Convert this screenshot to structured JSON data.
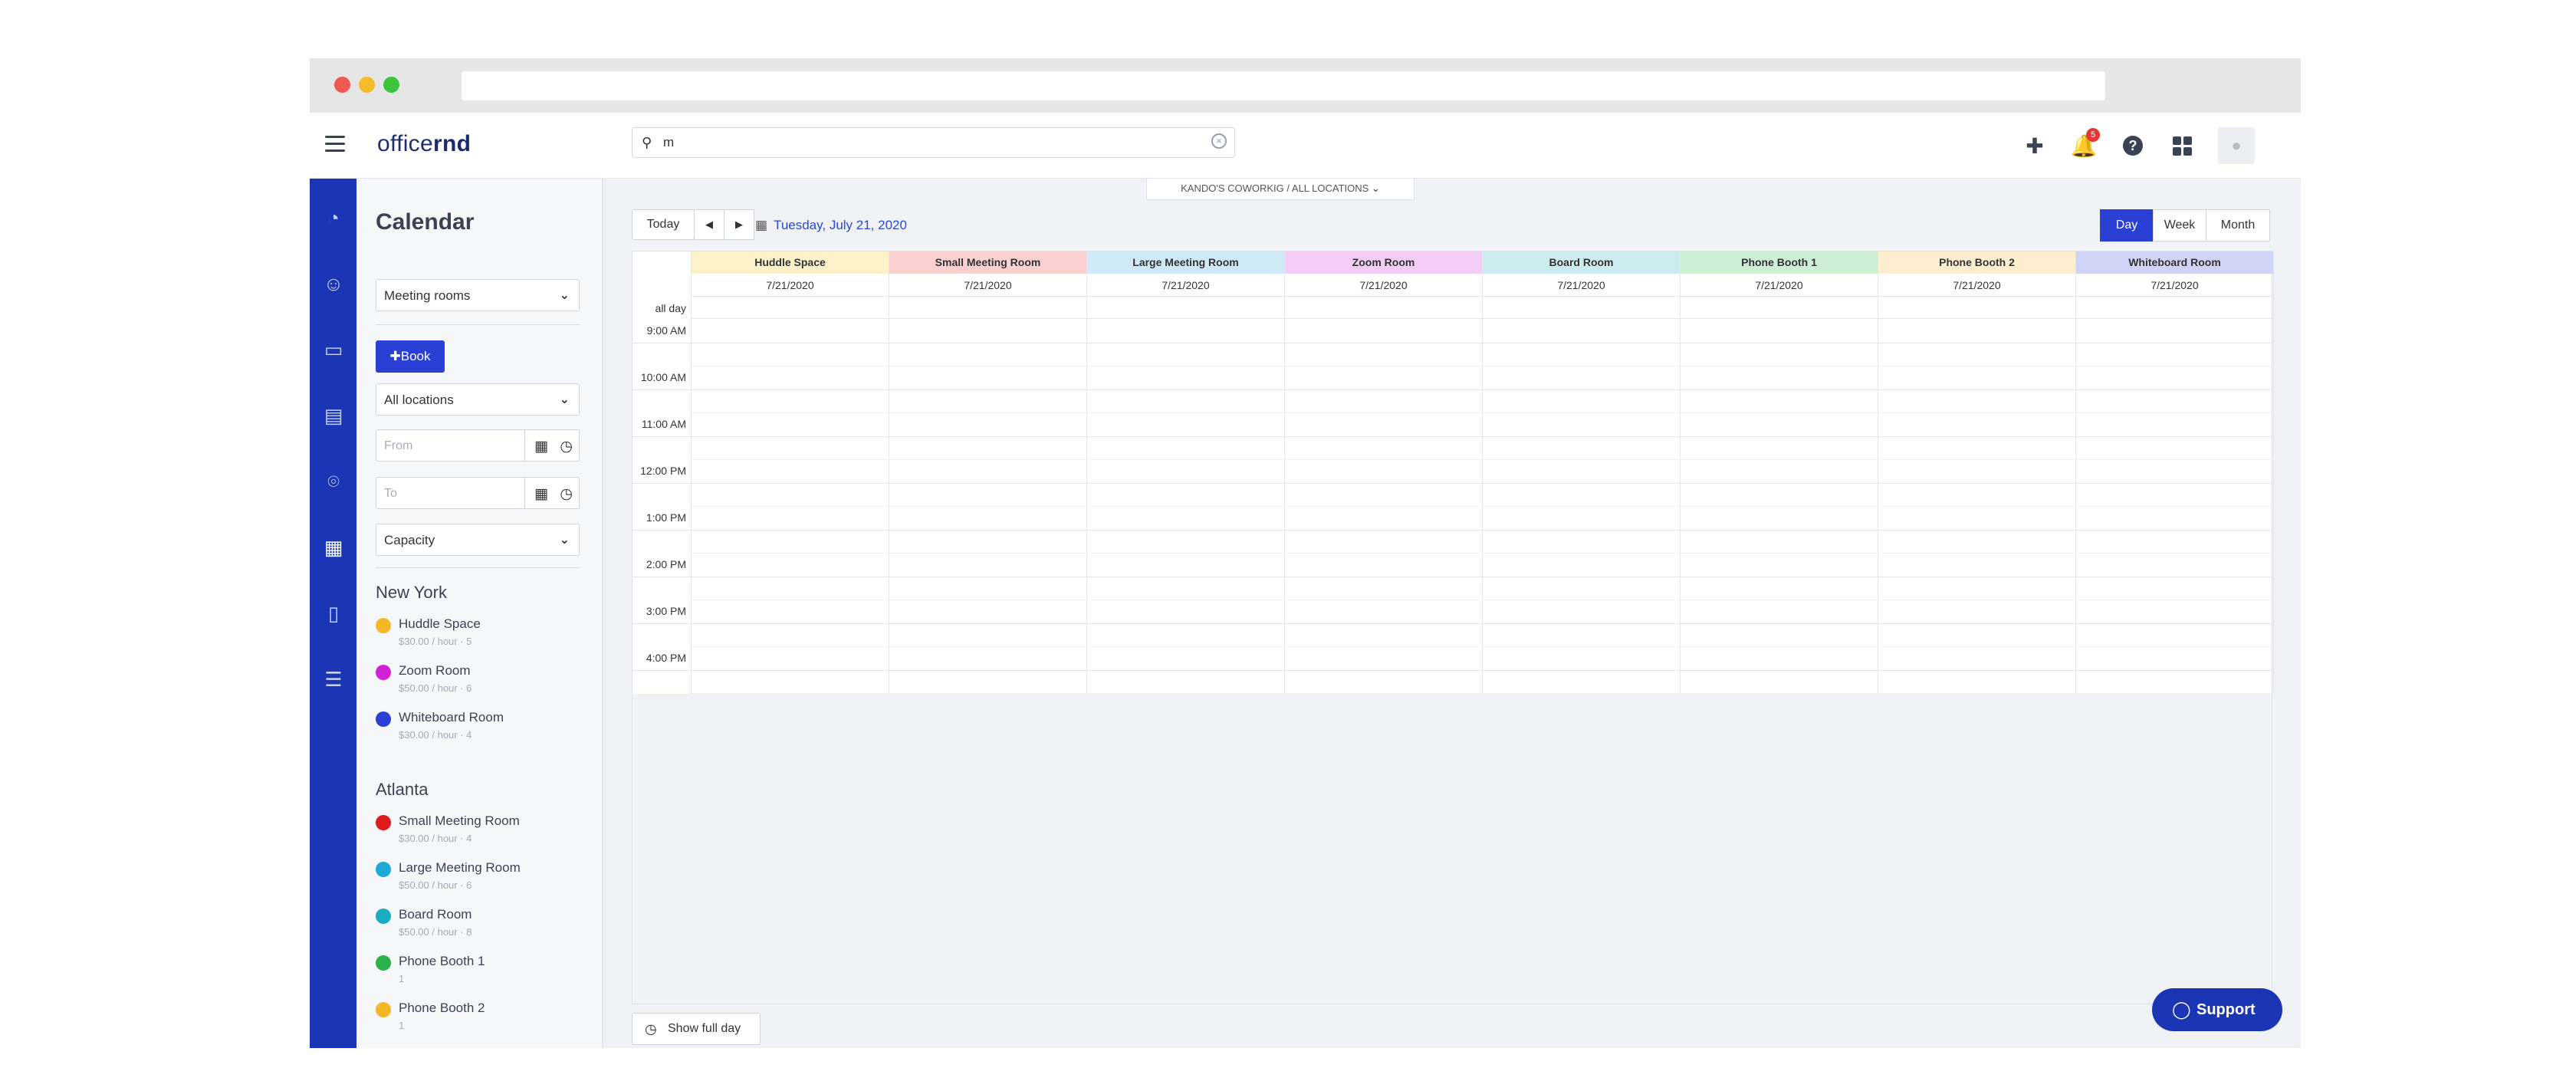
{
  "app": {
    "logo_light": "office",
    "logo_bold": "rnd"
  },
  "search": {
    "value": "m"
  },
  "header": {
    "notification_count": "5"
  },
  "sidebar": {
    "title": "Calendar",
    "resource_type": "Meeting rooms",
    "book_label": "Book",
    "locations_select": "All locations",
    "from_placeholder": "From",
    "to_placeholder": "To",
    "capacity_select": "Capacity",
    "groups": [
      {
        "name": "New York",
        "rooms": [
          {
            "name": "Huddle Space",
            "meta": "$30.00 / hour  ·  5",
            "color": "#f4b826"
          },
          {
            "name": "Zoom Room",
            "meta": "$50.00 / hour  ·  6",
            "color": "#d321d6"
          },
          {
            "name": "Whiteboard Room",
            "meta": "$30.00 / hour  ·  4",
            "color": "#2a3fd4"
          }
        ]
      },
      {
        "name": "Atlanta",
        "rooms": [
          {
            "name": "Small Meeting Room",
            "meta": "$30.00 / hour  ·  4",
            "color": "#e01b1b"
          },
          {
            "name": "Large Meeting Room",
            "meta": "$50.00 / hour  ·  6",
            "color": "#1ea9d6"
          },
          {
            "name": "Board Room",
            "meta": "$50.00 / hour  ·  8",
            "color": "#1aacc2"
          },
          {
            "name": "Phone Booth 1",
            "meta": "1",
            "color": "#2bb24c"
          },
          {
            "name": "Phone Booth 2",
            "meta": "1",
            "color": "#f4b826"
          }
        ]
      }
    ]
  },
  "main": {
    "location_tab": "KANDO'S COWORKIG  /  ALL LOCATIONS",
    "today_label": "Today",
    "prev_label": "◀",
    "next_label": "▶",
    "date_label": "Tuesday, July 21, 2020",
    "views": {
      "day": "Day",
      "week": "Week",
      "month": "Month"
    },
    "allday_label": "all day",
    "times": [
      "9:00 AM",
      "10:00 AM",
      "11:00 AM",
      "12:00 PM",
      "1:00 PM",
      "2:00 PM",
      "3:00 PM",
      "4:00 PM"
    ],
    "columns": [
      {
        "name": "Huddle Space",
        "date": "7/21/2020",
        "color": "#fbf2c9"
      },
      {
        "name": "Small Meeting Room",
        "date": "7/21/2020",
        "color": "#fbd0d0"
      },
      {
        "name": "Large Meeting Room",
        "date": "7/21/2020",
        "color": "#cfe9f7"
      },
      {
        "name": "Zoom Room",
        "date": "7/21/2020",
        "color": "#f3cdf5"
      },
      {
        "name": "Board Room",
        "date": "7/21/2020",
        "color": "#ccecf0"
      },
      {
        "name": "Phone Booth 1",
        "date": "7/21/2020",
        "color": "#cfeed6"
      },
      {
        "name": "Phone Booth 2",
        "date": "7/21/2020",
        "color": "#fdeed0"
      },
      {
        "name": "Whiteboard Room",
        "date": "7/21/2020",
        "color": "#d0d5f8"
      }
    ],
    "show_full_day": "Show full day"
  },
  "support": {
    "label": "Support"
  }
}
